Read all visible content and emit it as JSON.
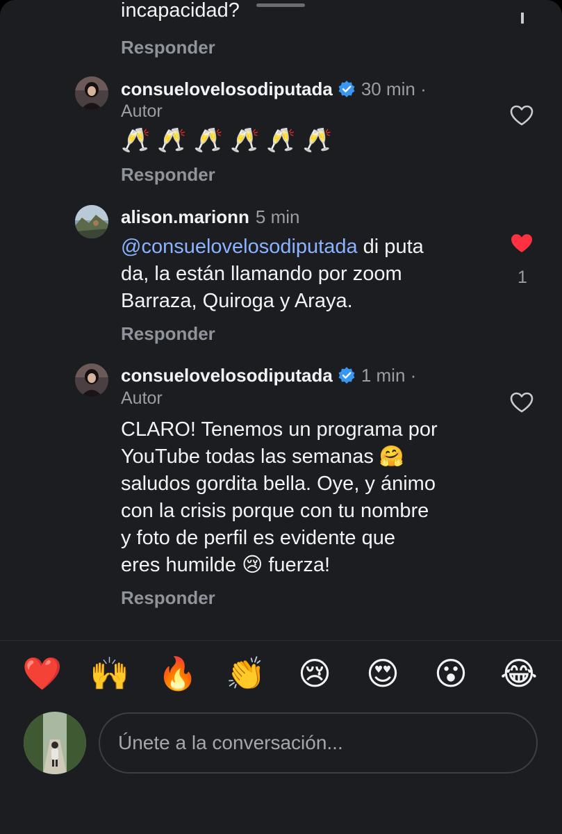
{
  "top": {
    "cut_text": "incapacidad?",
    "reply_label": "Responder"
  },
  "comments": [
    {
      "username": "consuelovelosodiputada",
      "verified": true,
      "time": "30 min ·",
      "badge": "Autor",
      "lines": [
        "🥂🥂🥂🥂🥂🥂"
      ],
      "reply_label": "Responder",
      "liked": false
    },
    {
      "username": "alison.marionn",
      "verified": false,
      "time": "5 min",
      "mention": "@consuelovelosodiputada",
      "lines": [
        " di puta",
        "da, la están llamando por zoom",
        "Barraza, Quiroga y Araya."
      ],
      "reply_label": "Responder",
      "liked": true,
      "like_count": "1"
    },
    {
      "username": "consuelovelosodiputada",
      "verified": true,
      "time": "1 min ·",
      "badge": "Autor",
      "lines": [
        "CLARO! Tenemos un programa por",
        "YouTube todas las semanas 🤗",
        "saludos gordita bella. Oye, y ánimo",
        "con la crisis porque con tu nombre",
        "y foto de perfil es evidente que",
        "eres humilde 😢 fuerza!"
      ],
      "reply_label": "Responder",
      "liked": false
    }
  ],
  "reactions": [
    "❤️",
    "🙌",
    "🔥",
    "👏",
    "😢",
    "😍",
    "😮",
    "😂"
  ],
  "composer": {
    "placeholder": "Únete a la conversación..."
  },
  "colors": {
    "background": "#1b1d21",
    "mention": "#8bb3ff",
    "verified": "#3897f0",
    "like_active": "#ff3040",
    "muted": "#9a9ea5"
  }
}
